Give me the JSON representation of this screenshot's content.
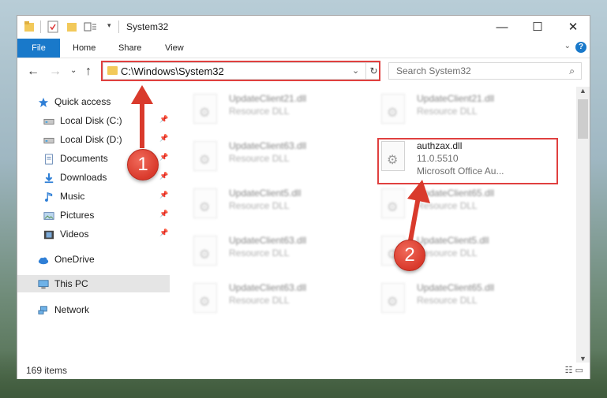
{
  "window": {
    "title": "System32",
    "controls": [
      "minimize-icon",
      "maximize-icon",
      "close-icon"
    ]
  },
  "ribbon": {
    "tabs": [
      "File",
      "Home",
      "Share",
      "View"
    ],
    "help": "?"
  },
  "navbar": {
    "address": "C:\\Windows\\System32",
    "search_placeholder": "Search System32"
  },
  "sidebar": {
    "items": [
      {
        "label": "Quick access",
        "icon": "star-icon"
      },
      {
        "label": "Local Disk (C:)",
        "icon": "drive-icon",
        "pinned": true
      },
      {
        "label": "Local Disk (D:)",
        "icon": "drive-icon",
        "pinned": true
      },
      {
        "label": "Documents",
        "icon": "documents-icon",
        "pinned": true
      },
      {
        "label": "Downloads",
        "icon": "download-icon",
        "pinned": true
      },
      {
        "label": "Music",
        "icon": "music-icon",
        "pinned": true
      },
      {
        "label": "Pictures",
        "icon": "pictures-icon",
        "pinned": true
      },
      {
        "label": "Videos",
        "icon": "videos-icon",
        "pinned": true
      },
      {
        "label": "OneDrive",
        "icon": "cloud-icon"
      },
      {
        "label": "This PC",
        "icon": "computer-icon",
        "selected": true
      },
      {
        "label": "Network",
        "icon": "network-icon"
      }
    ]
  },
  "files": [
    {
      "name": "UpdateClient21.dll",
      "type": "Resource DLL"
    },
    {
      "name": "UpdateClient21.dll",
      "type": "Resource DLL"
    },
    {
      "name": "UpdateClient63.dll",
      "type": "Resource DLL"
    },
    {
      "name": "authzax.dll",
      "version": "11.0.5510",
      "description": "Microsoft Office Au...",
      "highlighted": true
    },
    {
      "name": "UpdateClient5.dll",
      "type": "Resource DLL"
    },
    {
      "name": "UpdateClient65.dll",
      "type": "Resource DLL"
    },
    {
      "name": "UpdateClient63.dll",
      "type": "Resource DLL"
    },
    {
      "name": "UpdateClient5.dll",
      "type": "Resource DLL"
    },
    {
      "name": "UpdateClient63.dll",
      "type": "Resource DLL"
    },
    {
      "name": "UpdateClient65.dll",
      "type": "Resource DLL"
    }
  ],
  "status": {
    "item_count": "169 items"
  },
  "callouts": [
    "1",
    "2"
  ],
  "colors": {
    "accent": "#1979ca",
    "highlight": "#e0403f"
  }
}
